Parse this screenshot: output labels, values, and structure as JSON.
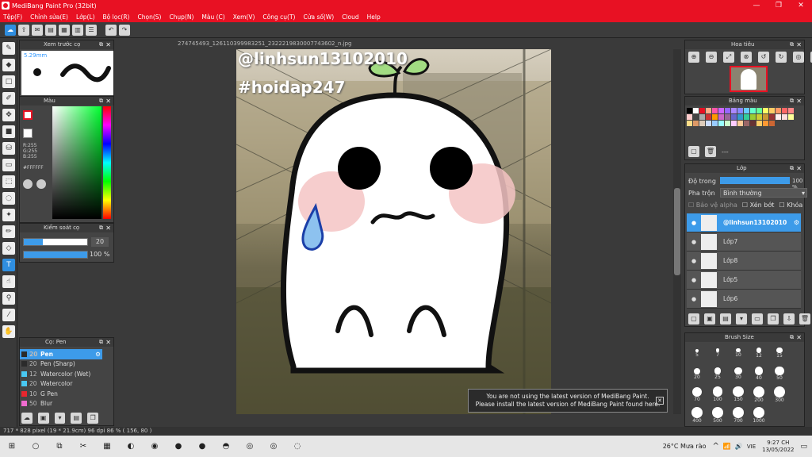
{
  "window": {
    "title": "MediBang Paint Pro (32bit)",
    "min": "—",
    "max": "❐",
    "close": "✕"
  },
  "menu": [
    "Tệp(F)",
    "Chỉnh sửa(E)",
    "Lớp(L)",
    "Bộ lọc(R)",
    "Chọn(S)",
    "Chụp(N)",
    "Màu (C)",
    "Xem(V)",
    "Công cụ(T)",
    "Cửa số(W)",
    "Cloud",
    "Help"
  ],
  "document": {
    "tab": "274745493_126110399983251_2322219830007743602_n.jpg",
    "watermark1": "@linhsun13102010",
    "watermark2": "#hoidap247"
  },
  "preview": {
    "title": "Xem trước cọ",
    "size": "5.29mm"
  },
  "color": {
    "title": "Màu",
    "r": "R:255",
    "g": "G:255",
    "b": "B:255",
    "hex": "#FFFFFF"
  },
  "brush_control": {
    "title": "Kiểm soát cọ",
    "size": "20",
    "opacity": "100 %",
    "size_fraction": 0.3,
    "opacity_fraction": 1.0
  },
  "pen": {
    "title": "Cọ: Pen",
    "items": [
      {
        "size": "20",
        "name": "Pen",
        "color": "#2b2b2b"
      },
      {
        "size": "20",
        "name": "Pen (Sharp)",
        "color": "#2b2b2b"
      },
      {
        "size": "12",
        "name": "Watercolor (Wet)",
        "color": "#49c8f2"
      },
      {
        "size": "20",
        "name": "Watercolor",
        "color": "#49c8f2"
      },
      {
        "size": "10",
        "name": "G Pen",
        "color": "#e8262e"
      },
      {
        "size": "50",
        "name": "Blur",
        "color": "#f06bd0"
      }
    ]
  },
  "navigator": {
    "title": "Hoa tiêu"
  },
  "palette": {
    "title": "Bảng màu",
    "label": "---"
  },
  "layers": {
    "title": "Lớp",
    "opacity_label": "Độ trong",
    "opacity_value": "100 %",
    "blend_label": "Pha trộn",
    "blend_value": "Bình thường",
    "protect_alpha": "Bảo vệ alpha",
    "clipping": "Xén bớt",
    "lock": "Khóa",
    "items": [
      "@linhsun13102010",
      "Lớp7",
      "Lớp8",
      "Lớp5",
      "Lớp6"
    ]
  },
  "brush_size": {
    "title": "Brush Size",
    "sizes": [
      "5",
      "7",
      "10",
      "12",
      "15",
      "20",
      "25",
      "30",
      "40",
      "50",
      "70",
      "100",
      "150",
      "200",
      "300",
      "400",
      "500",
      "700",
      "1000"
    ]
  },
  "notice": {
    "line1": "You are not using the latest version of MediBang Paint.",
    "line2": "Please install the latest version of MediBang Paint found here.",
    "close": "✕"
  },
  "status": {
    "text": "717 * 828 pixel   (19 * 21.9cm)   96 dpi   86 %   ( 156, 80 )"
  },
  "taskbar": {
    "weather": "26°C  Mưa rào",
    "lang": "VIE",
    "time": "9:27 CH",
    "date": "13/05/2022"
  }
}
